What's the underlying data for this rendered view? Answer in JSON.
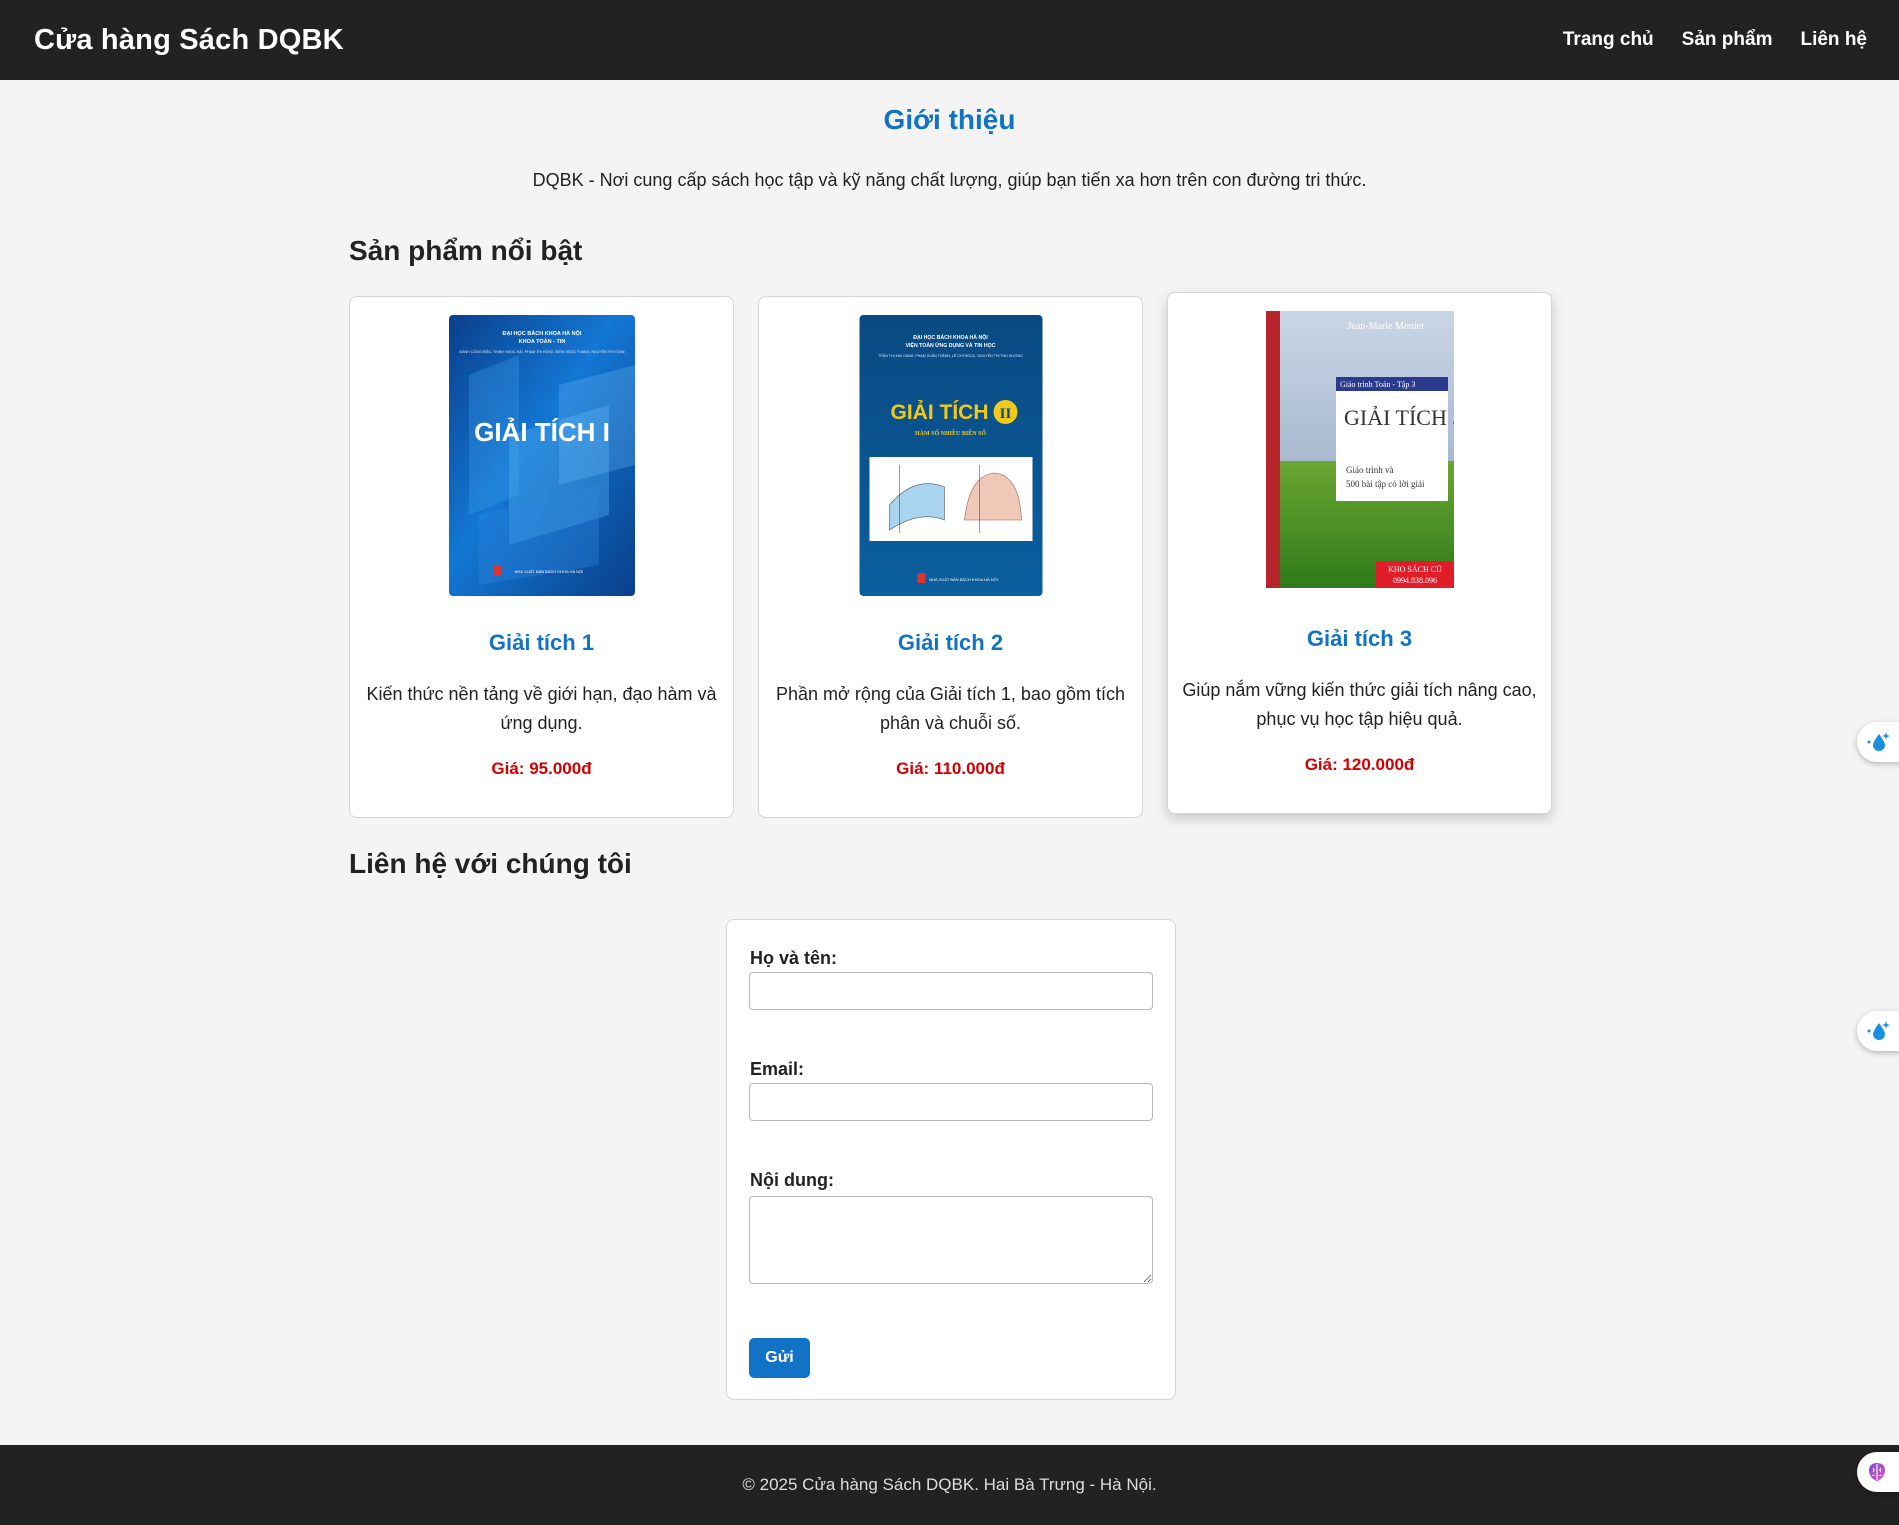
{
  "header": {
    "brand": "Cửa hàng Sách DQBK",
    "nav": [
      {
        "label": "Trang chủ"
      },
      {
        "label": "Sản phẩm"
      },
      {
        "label": "Liên hệ"
      }
    ]
  },
  "intro": {
    "title": "Giới thiệu",
    "text": "DQBK - Nơi cung cấp sách học tập và kỹ năng chất lượng, giúp bạn tiến xa hơn trên con đường tri thức."
  },
  "products": {
    "heading": "Sản phẩm nổi bật",
    "items": [
      {
        "title": "Giải tích 1",
        "description": "Kiến thức nền tảng về giới hạn, đạo hàm và ứng dụng.",
        "price": "Giá: 95.000đ",
        "cover": {
          "publisher_top": "ĐẠI HỌC BÁCH KHOA HÀ NỘI",
          "department": "KHOA TOÁN - TIN",
          "authors": "ĐÀNH CÔNG ĐIỆU, TRỊNH NGỌC HẢI, PHẠM THỊ HỒNG, ĐIỀN NGỌC THÀNG, NGUYỄN THỊ TOAN",
          "title": "GIẢI TÍCH I",
          "publisher_bottom": "NHÀ XUẤT BẢN BÁCH KHOA HÀ NỘI"
        }
      },
      {
        "title": "Giải tích 2",
        "description": "Phần mở rộng của Giải tích 1, bao gồm tích phân và chuỗi số.",
        "price": "Giá: 110.000đ",
        "cover": {
          "publisher_top": "ĐẠI HỌC BÁCH KHOA HÀ NỘI",
          "department": "VIỆN TOÁN ỨNG DỤNG VÀ TIN HỌC",
          "authors": "TRẦN THỊ KIM OANH, PHẠM XUÂN THÀNH, LÊ CHÍ NGỌC, NGUYỄN THỊ THU HƯƠNG",
          "title": "GIẢI TÍCH",
          "title_badge": "II",
          "subtitle": "HÀM SỐ NHIỀU BIẾN SỐ",
          "publisher_bottom": "NHÀ XUẤT BẢN BÁCH KHOA HÀ NỘI"
        }
      },
      {
        "title": "Giải tích 3",
        "description": "Giúp nắm vững kiến thức giải tích nâng cao, phục vụ học tập hiệu quả.",
        "price": "Giá: 120.000đ",
        "cover": {
          "author": "Jean-Marie Monier",
          "series": "Giáo trình Toán - Tập 3",
          "title": "GIẢI TÍCH 3",
          "subtitle_1": "Giáo trình và",
          "subtitle_2": "500 bài tập có lời giải",
          "stamp_1": "KHO SÁCH CŨ",
          "stamp_2": "0994.838.096"
        }
      }
    ]
  },
  "contact": {
    "heading": "Liên hệ với chúng tôi",
    "name_label": "Họ và tên:",
    "email_label": "Email:",
    "message_label": "Nội dung:",
    "submit_label": "Gửi"
  },
  "footer": {
    "text": "© 2025 Cửa hàng Sách DQBK. Hai Bà Trưng - Hà Nội."
  },
  "colors": {
    "topbar": "#222222",
    "accent": "#1273c6",
    "price": "#d40000",
    "background": "#f4f4f4"
  }
}
